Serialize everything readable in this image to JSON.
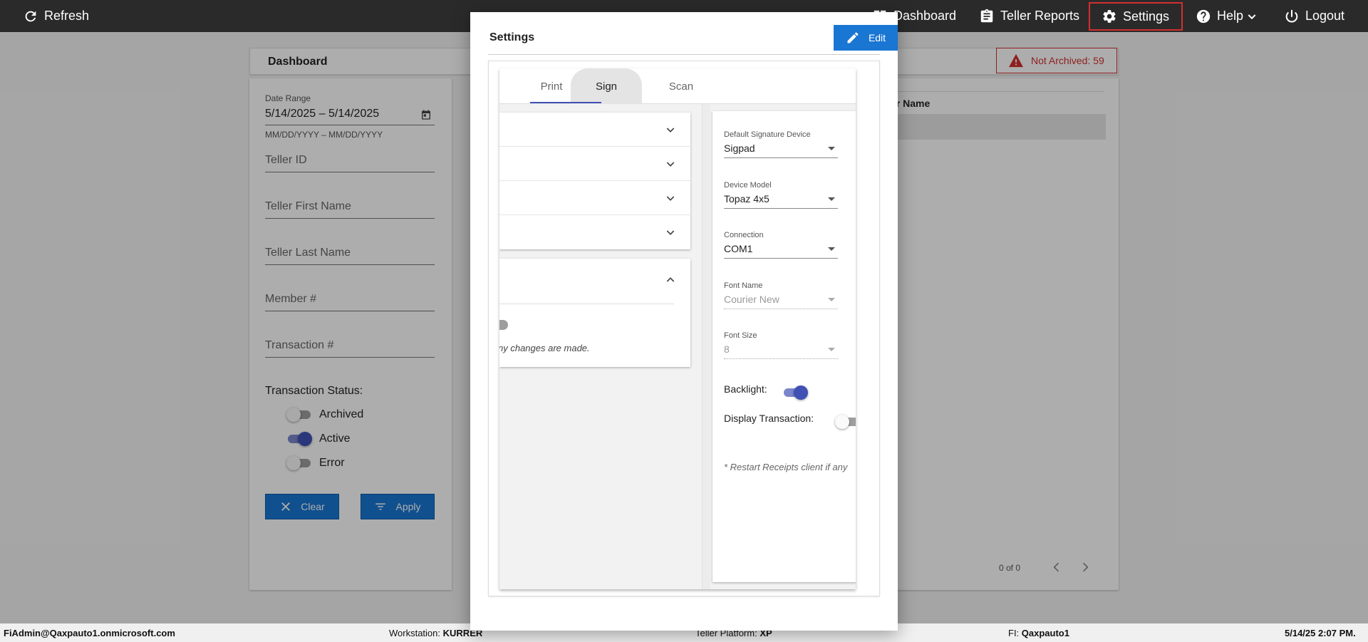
{
  "topbar": {
    "refresh": "Refresh",
    "dashboard": "Dashboard",
    "teller_reports": "Teller Reports",
    "settings": "Settings",
    "help": "Help",
    "logout": "Logout"
  },
  "dashboard": {
    "title": "Dashboard",
    "not_archived": "Not Archived: 59"
  },
  "filters": {
    "date_range_label": "Date Range",
    "date_range_value": "5/14/2025 – 5/14/2025",
    "date_hint": "MM/DD/YYYY – MM/DD/YYYY",
    "teller_id": "Teller ID",
    "teller_first_name": "Teller First Name",
    "teller_last_name": "Teller Last Name",
    "member": "Member #",
    "transaction": "Transaction #",
    "status_title": "Transaction Status:",
    "status_archived": "Archived",
    "status_active": "Active",
    "status_error": "Error",
    "clear": "Clear",
    "apply": "Apply"
  },
  "results": {
    "column_partial": "er Name",
    "pager": "0 of 0"
  },
  "modal": {
    "title": "Settings",
    "edit": "Edit",
    "tabs": [
      "Print",
      "Sign",
      "Scan"
    ],
    "active_tab": "Sign",
    "left_note": "ny changes are made.",
    "sign": {
      "device_label": "Default Signature Device",
      "device_value": "Sigpad",
      "model_label": "Device Model",
      "model_value": "Topaz 4x5",
      "connection_label": "Connection",
      "connection_value": "COM1",
      "font_name_label": "Font Name",
      "font_name_value": "Courier New",
      "font_size_label": "Font Size",
      "font_size_value": "8",
      "backlight_label": "Backlight:",
      "backlight_on": true,
      "display_transaction_label": "Display Transaction:",
      "display_transaction_on": false,
      "restart_note": "* Restart Receipts client if any"
    }
  },
  "footer": {
    "user": "FiAdmin@Qaxpauto1.onmicrosoft.com",
    "workstation_label": "Workstation:",
    "workstation_value": "KURRER",
    "platform_label": "Teller Platform:",
    "platform_value": "XP",
    "fi_label": "FI:",
    "fi_value": "Qaxpauto1",
    "datetime": "5/14/25 2:07 PM."
  },
  "colors": {
    "topbar": "#2a2a2a",
    "primary_button": "#1976d2",
    "toggle_on": "#3f51b5",
    "alert": "#d32f2f"
  }
}
